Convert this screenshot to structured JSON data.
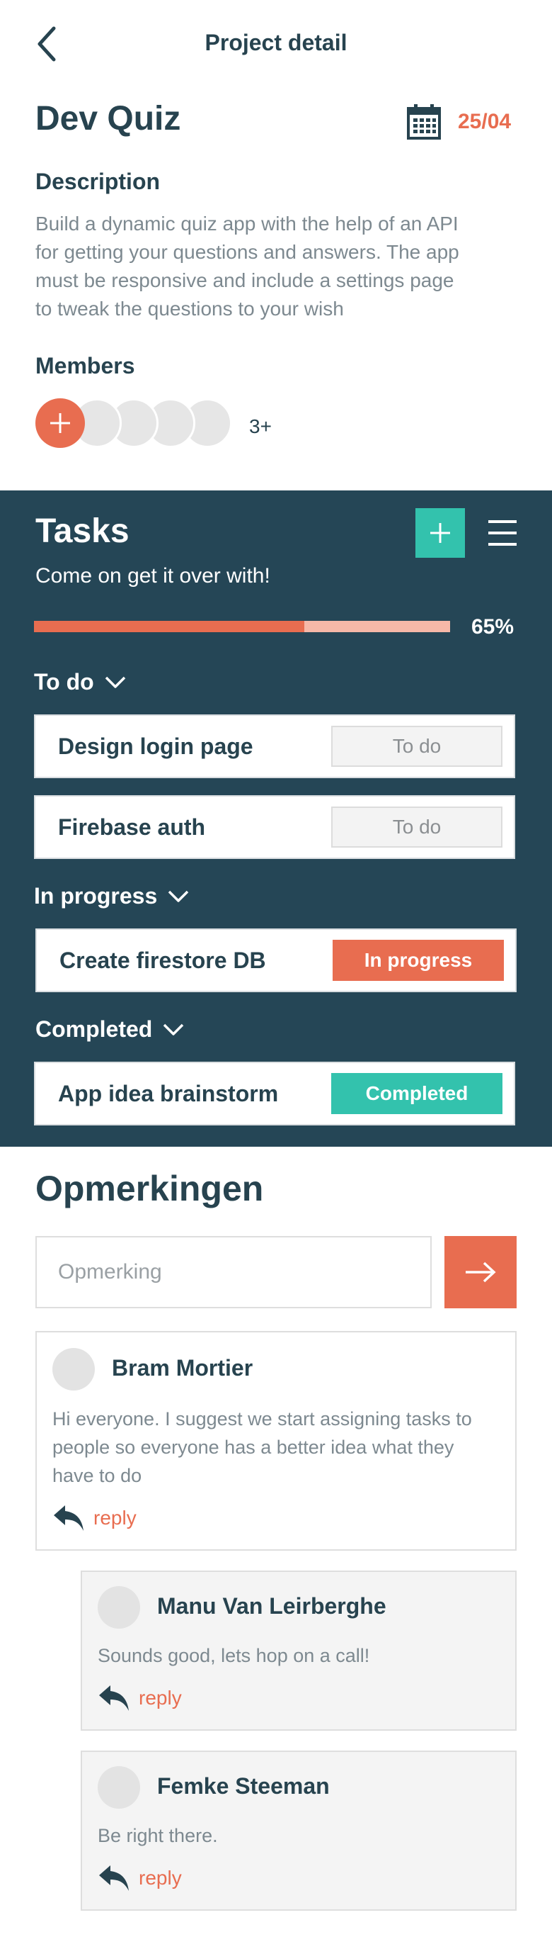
{
  "header": {
    "title": "Project detail"
  },
  "project": {
    "name": "Dev Quiz",
    "due_date": "25/04",
    "description_heading": "Description",
    "description_lines": [
      "Build a dynamic quiz app with the help of an API",
      "for getting your questions and answers. The app",
      "must be responsive and include a settings page",
      "to tweak the questions to your wish"
    ],
    "members_heading": "Members",
    "members_more": "3+"
  },
  "tasks": {
    "title": "Tasks",
    "subtitle": "Come on get it over with!",
    "progress_value": 0.65,
    "progress_label": "65%",
    "groups": [
      {
        "label": "To do",
        "items": [
          {
            "name": "Design login page",
            "status": "To do"
          },
          {
            "name": "Firebase auth",
            "status": "To do"
          }
        ]
      },
      {
        "label": "In progress",
        "items": [
          {
            "name": "Create firestore DB",
            "status": "In progress"
          }
        ]
      },
      {
        "label": "Completed",
        "items": [
          {
            "name": "App idea brainstorm",
            "status": "Completed"
          }
        ]
      }
    ]
  },
  "comments": {
    "title": "Opmerkingen",
    "input_placeholder": "Opmerking",
    "reply_label": "reply",
    "items": [
      {
        "author": "Bram Mortier",
        "lines": [
          "Hi everyone. I suggest we start assigning tasks to",
          "people so everyone has a better idea what they",
          "have to do"
        ]
      },
      {
        "author": "Manu Van Leirberghe",
        "lines": [
          "Sounds good, lets hop on a call!"
        ]
      },
      {
        "author": "Femke Steeman",
        "lines": [
          "Be right there."
        ]
      }
    ]
  },
  "colors": {
    "accent": "#e86d50",
    "teal": "#33c2ad",
    "panel": "#254656",
    "text": "#27434f",
    "muted": "#7d8990"
  },
  "icons": {
    "back": "chevron-left-icon",
    "calendar": "calendar-icon",
    "add": "plus-icon",
    "menu": "hamburger-menu-icon",
    "chevron": "chevron-down-icon",
    "send": "arrow-right-icon",
    "reply": "reply-arrow-icon"
  }
}
